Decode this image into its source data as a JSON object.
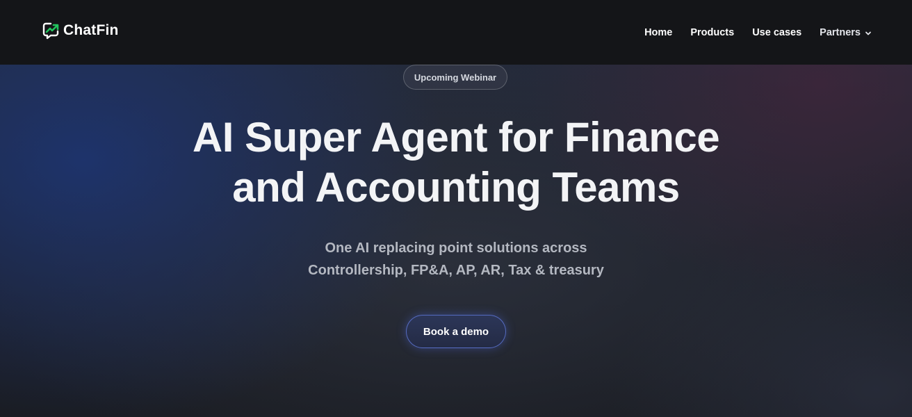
{
  "brand": {
    "name": "ChatFin",
    "icon": "chatfin-logo-icon",
    "accent": "#22c55e"
  },
  "nav": {
    "items": [
      {
        "label": "Home"
      },
      {
        "label": "Products"
      },
      {
        "label": "Use cases"
      },
      {
        "label": "Partners",
        "icon": "chevron-down-icon"
      }
    ]
  },
  "hero": {
    "badge": "Upcoming Webinar",
    "headline_line1": "AI Super Agent for Finance",
    "headline_line2": "and Accounting Teams",
    "subhead_line1": "One AI replacing point solutions across",
    "subhead_line2": "Controllership, FP&A, AP, AR, Tax & treasury",
    "cta": "Book a demo"
  },
  "colors": {
    "navbar_bg": "#141518",
    "hero_bg": "#1d2029",
    "cta_border": "#6e8cff"
  }
}
